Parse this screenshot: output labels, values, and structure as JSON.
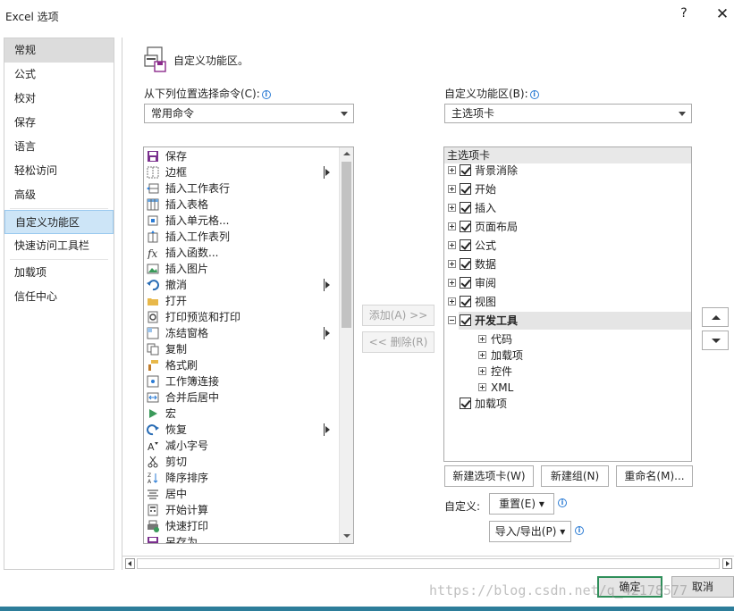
{
  "window": {
    "title": "Excel 选项",
    "help": "?",
    "close": "✕"
  },
  "nav": [
    {
      "label": "常规"
    },
    {
      "label": "公式"
    },
    {
      "label": "校对"
    },
    {
      "label": "保存"
    },
    {
      "label": "语言"
    },
    {
      "label": "轻松访问"
    },
    {
      "label": "高级"
    },
    {
      "label": "自定义功能区",
      "selected": true
    },
    {
      "label": "快速访问工具栏"
    },
    {
      "label": "加载项"
    },
    {
      "label": "信任中心"
    }
  ],
  "header": {
    "title": "自定义功能区。"
  },
  "left": {
    "label": "从下列位置选择命令(C):",
    "combo_value": "常用命令",
    "commands": [
      {
        "label": "保存",
        "icon": "save-icon",
        "submenu": false
      },
      {
        "label": "边框",
        "icon": "border-icon",
        "submenu": true
      },
      {
        "label": "插入工作表行",
        "icon": "insert-row-icon",
        "submenu": false
      },
      {
        "label": "插入表格",
        "icon": "insert-table-icon",
        "submenu": false
      },
      {
        "label": "插入单元格...",
        "icon": "insert-cells-icon",
        "submenu": false
      },
      {
        "label": "插入工作表列",
        "icon": "insert-column-icon",
        "submenu": false
      },
      {
        "label": "插入函数...",
        "icon": "function-icon",
        "submenu": false
      },
      {
        "label": "插入图片",
        "icon": "picture-icon",
        "submenu": false
      },
      {
        "label": "撤消",
        "icon": "undo-icon",
        "submenu": true
      },
      {
        "label": "打开",
        "icon": "open-folder-icon",
        "submenu": false
      },
      {
        "label": "打印预览和打印",
        "icon": "print-preview-icon",
        "submenu": false
      },
      {
        "label": "冻结窗格",
        "icon": "freeze-panes-icon",
        "submenu": true
      },
      {
        "label": "复制",
        "icon": "copy-icon",
        "submenu": false
      },
      {
        "label": "格式刷",
        "icon": "format-painter-icon",
        "submenu": false
      },
      {
        "label": "工作簿连接",
        "icon": "connections-icon",
        "submenu": false
      },
      {
        "label": "合并后居中",
        "icon": "merge-center-icon",
        "submenu": false
      },
      {
        "label": "宏",
        "icon": "macro-icon",
        "submenu": false
      },
      {
        "label": "恢复",
        "icon": "redo-icon",
        "submenu": true
      },
      {
        "label": "减小字号",
        "icon": "decrease-font-icon",
        "submenu": false
      },
      {
        "label": "剪切",
        "icon": "cut-icon",
        "submenu": false
      },
      {
        "label": "降序排序",
        "icon": "sort-desc-icon",
        "submenu": false
      },
      {
        "label": "居中",
        "icon": "center-align-icon",
        "submenu": false
      },
      {
        "label": "开始计算",
        "icon": "calculator-icon",
        "submenu": false
      },
      {
        "label": "快速打印",
        "icon": "quick-print-icon",
        "submenu": false
      },
      {
        "label": "另存为",
        "icon": "save-as-icon",
        "submenu": false
      }
    ]
  },
  "middle": {
    "add": "添加(A) >>",
    "remove": "<< 删除(R)"
  },
  "right": {
    "label": "自定义功能区(B):",
    "combo_value": "主选项卡",
    "tree_header": "主选项卡",
    "tabs": [
      {
        "label": "背景消除",
        "checked": true
      },
      {
        "label": "开始",
        "checked": true
      },
      {
        "label": "插入",
        "checked": true
      },
      {
        "label": "页面布局",
        "checked": true
      },
      {
        "label": "公式",
        "checked": true
      },
      {
        "label": "数据",
        "checked": true
      },
      {
        "label": "审阅",
        "checked": true
      },
      {
        "label": "视图",
        "checked": true
      },
      {
        "label": "开发工具",
        "checked": true,
        "expanded": true,
        "selected": true
      }
    ],
    "groups": [
      {
        "label": "代码"
      },
      {
        "label": "加载项"
      },
      {
        "label": "控件"
      },
      {
        "label": "XML"
      }
    ],
    "last_tab": {
      "label": "加载项",
      "checked": true
    },
    "new_tab": "新建选项卡(W)",
    "new_group": "新建组(N)",
    "rename": "重命名(M)...",
    "customize_label": "自定义:",
    "reset": "重置(E) ▾",
    "import_export": "导入/导出(P) ▾"
  },
  "footer": {
    "ok": "确定",
    "cancel": "取消"
  },
  "watermark": "https://blog.csdn.net/q_42178577"
}
